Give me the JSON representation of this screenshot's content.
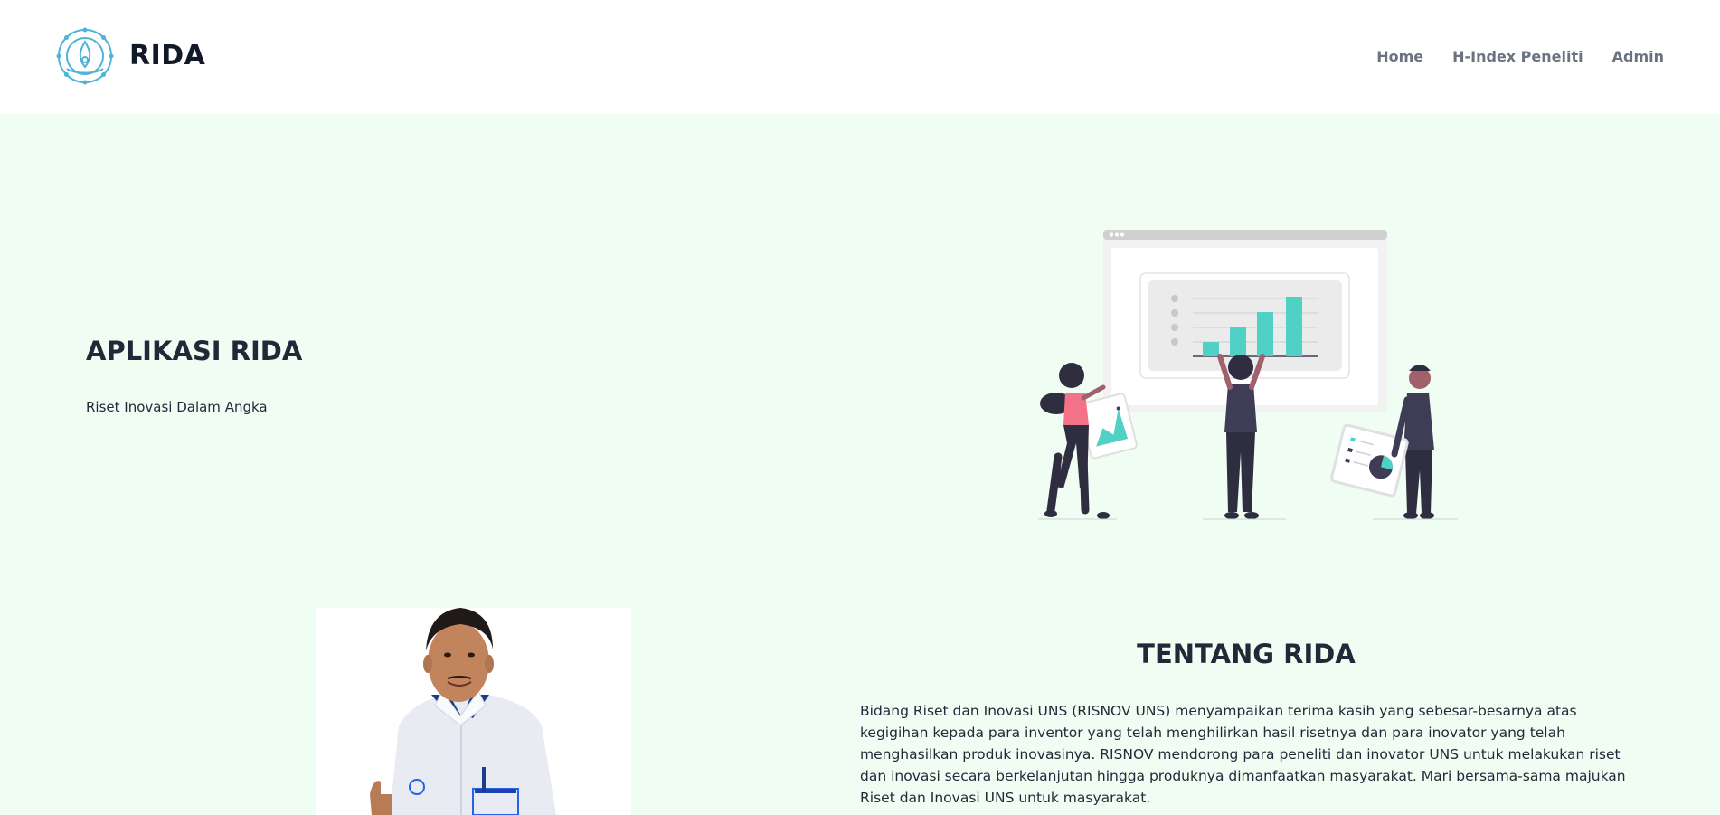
{
  "header": {
    "brand": "RIDA",
    "logo_icon": "uns-emblem-icon",
    "nav": [
      {
        "label": "Home"
      },
      {
        "label": "H-Index Peneliti"
      },
      {
        "label": "Admin"
      }
    ]
  },
  "hero": {
    "title": "APLIKASI RIDA",
    "subtitle": "Riset Inovasi Dalam Angka",
    "illustration_icon": "data-analysis-illustration"
  },
  "about": {
    "title": "TENTANG RIDA",
    "body": "Bidang Riset dan Inovasi UNS (RISNOV UNS) menyampaikan terima kasih yang sebesar-besarnya atas kegigihan kepada para inventor yang telah menghilirkan hasil risetnya dan para inovator yang telah menghasilkan produk inovasinya. RISNOV mendorong para peneliti dan inovator UNS untuk melakukan riset dan inovasi secara berkelanjutan hingga produknya dimanfaatkan masyarakat. Mari bersama-sama majukan Riset dan Inovasi UNS untuk masyarakat.",
    "photo_icon": "person-photo"
  },
  "colors": {
    "hero_bg": "#effdf3",
    "accent": "#4fd1c5",
    "pink": "#f472b6",
    "dark": "#2f2e41"
  }
}
